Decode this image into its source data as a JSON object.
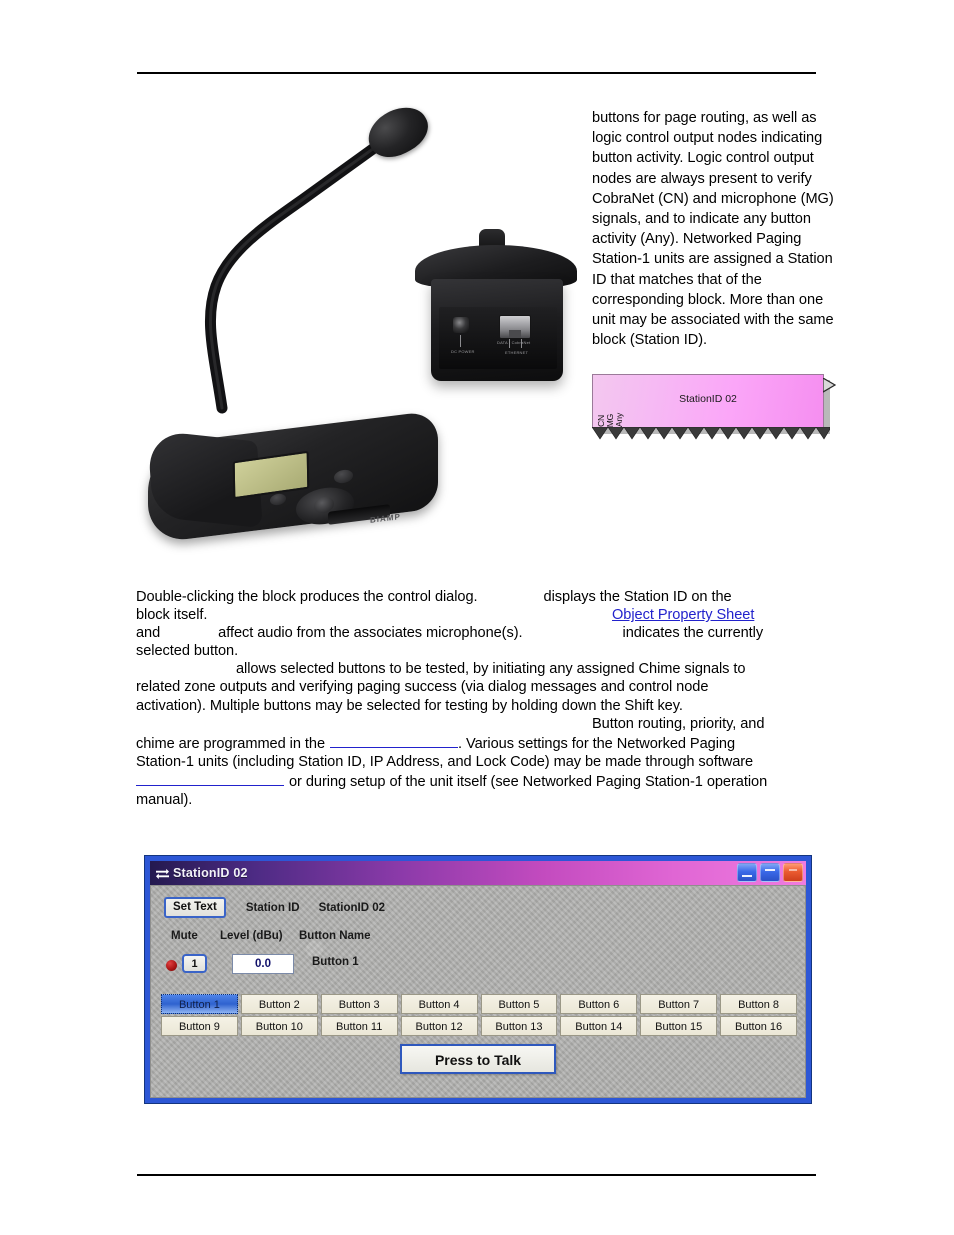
{
  "document": {
    "rules": {
      "top_label": "header-rule",
      "bottom_label": "footer-rule"
    }
  },
  "photo": {
    "caption": "Networked Paging Station-1 gooseneck microphone unit and rear connector view",
    "brand_mark": "BIAMP",
    "rear_labels": {
      "jack": "DC POWER",
      "rj45_left": "DATA / CobraNet",
      "rj45_right": "PoE",
      "group": "ETHERNET"
    }
  },
  "description": {
    "paragraph": "buttons for page routing, as well as logic control output nodes indicating button activity. Logic control output nodes are always present to verify CobraNet (CN) and microphone (MG) signals, and to indicate any button activity (Any). Networked Paging Station-1 units are assigned a Station ID that matches that of the corresponding block. More than one unit may be associated with the same block (Station ID)."
  },
  "block": {
    "title": "StationID 02",
    "node_labels": [
      "CN",
      "MG",
      "Any"
    ],
    "fill_color": "#fba6f8",
    "border_color": "#9b7a99"
  },
  "body": {
    "lines": [
      {
        "left": "Double-clicking the block produces the control dialog.",
        "gap": 62,
        "right": "displays the Station ID on the"
      },
      {
        "left": "block itself.",
        "gap": 0,
        "right": ""
      },
      {
        "left": "and",
        "gap": 52,
        "mid": "affect audio from the associates microphone(s).",
        "gap2": 96,
        "right": "indicates the currently"
      },
      {
        "left": "selected button.",
        "gap": 0,
        "right": ""
      },
      {
        "lead": 98,
        "text": "allows selected buttons to be tested, by initiating any assigned Chime signals to"
      },
      {
        "text": "related zone outputs and verifying paging success (via dialog messages and control node"
      },
      {
        "text": "activation). Multiple buttons may be selected for testing by holding down the Shift key."
      },
      {
        "lead": 450,
        "text": "Button routing, priority, and"
      },
      {
        "text": "chime are programmed in the",
        "blank_width": 128,
        "tail": ". Various settings for the Networked Paging"
      },
      {
        "text": "Station-1 units (including Station ID, IP Address, and Lock Code) may be made through software"
      },
      {
        "blank_first_width": 148,
        "tail": "or during setup of the unit itself (see Networked Paging Station-1 operation"
      },
      {
        "text": "manual)."
      }
    ],
    "link_text": "Object Property Sheet",
    "link_color": "#2222cc"
  },
  "dialog": {
    "title": "StationID 02",
    "title_icon": "two-way-arrows-icon",
    "window_buttons": [
      {
        "name": "minimize",
        "glyph": "_",
        "color": "#3a69e8"
      },
      {
        "name": "maximize",
        "glyph": "-",
        "color": "#3a69e8"
      },
      {
        "name": "close",
        "glyph": "x",
        "color": "#ea5a30"
      }
    ],
    "set_text_label": "Set Text",
    "station_id_label": "Station ID",
    "station_id_value": "StationID 02",
    "headers": {
      "mute": "Mute",
      "level": "Level (dBu)",
      "button_name": "Button Name"
    },
    "channel": {
      "mute_number": "1",
      "level_value": "0.0",
      "button_name": "Button 1",
      "mute_led_color": "#a81414"
    },
    "buttons": [
      "Button 1",
      "Button 2",
      "Button 3",
      "Button 4",
      "Button 5",
      "Button 6",
      "Button 7",
      "Button 8",
      "Button 9",
      "Button 10",
      "Button 11",
      "Button 12",
      "Button 13",
      "Button 14",
      "Button 15",
      "Button 16"
    ],
    "selected_button_index": 0,
    "press_to_talk_label": "Press to Talk",
    "accent_border_color": "#2d57d6"
  }
}
